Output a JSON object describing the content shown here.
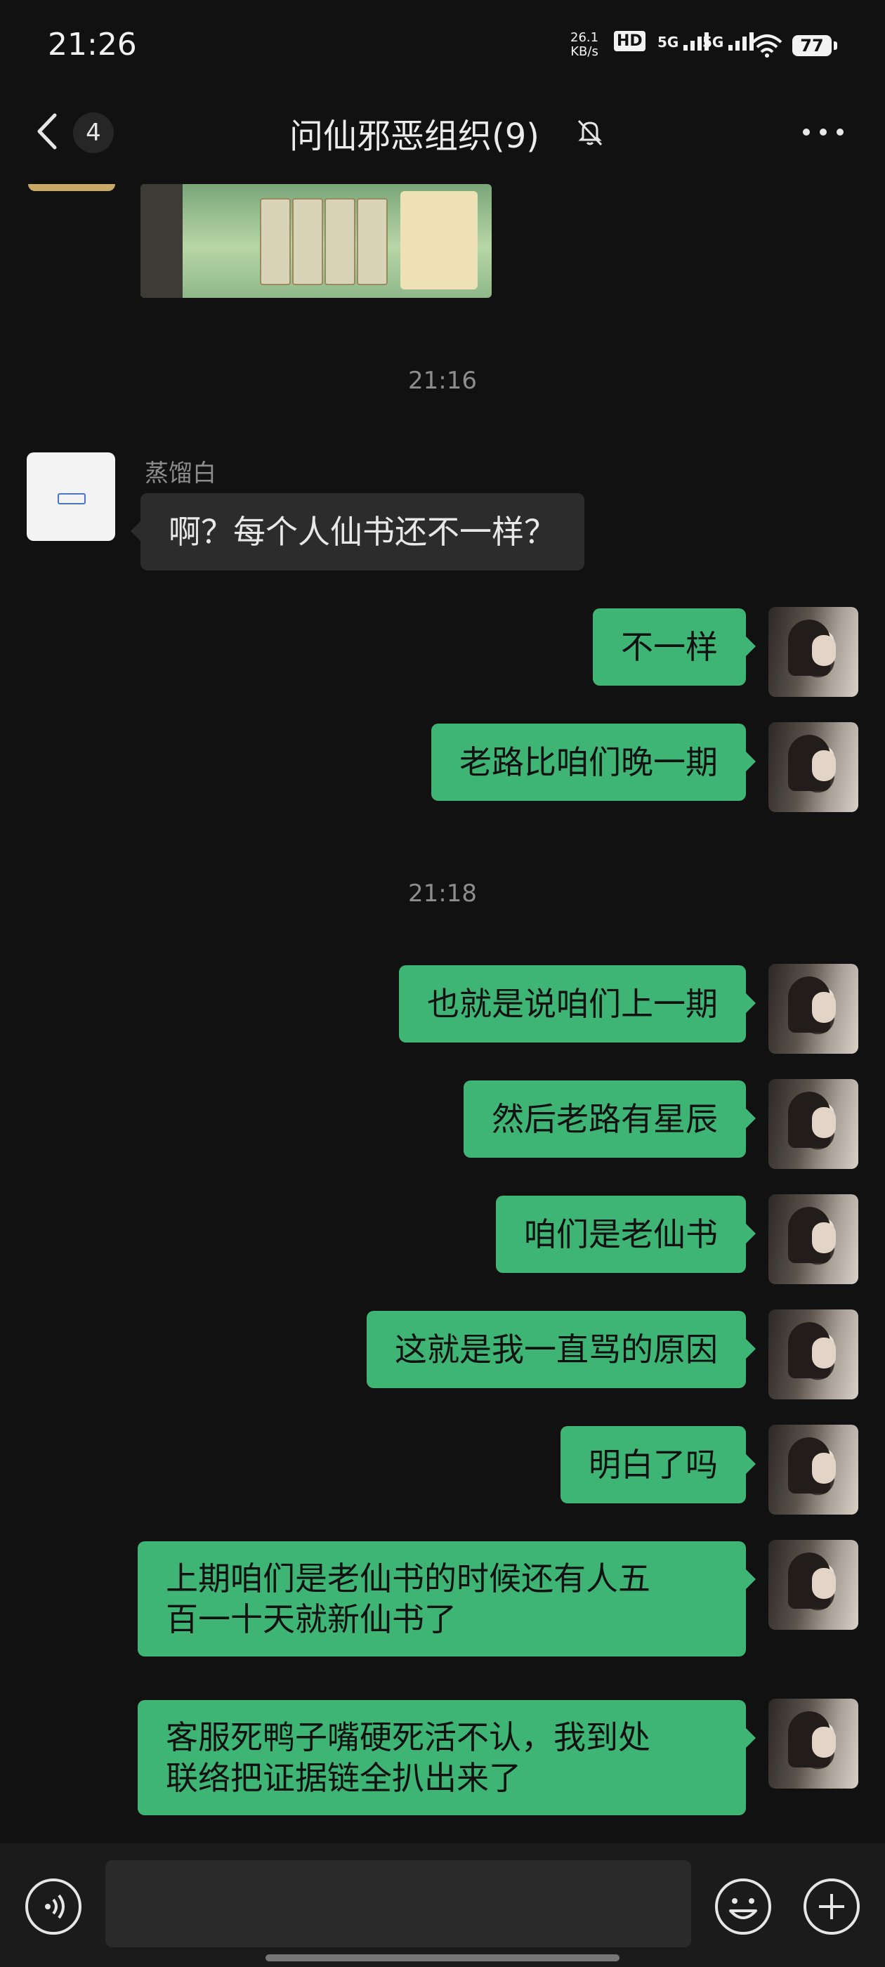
{
  "status_bar": {
    "time": "21:26",
    "net_speed": "26.1",
    "net_unit": "KB/s",
    "hd_label": "HD",
    "signal_1": "5G",
    "signal_2": "5G",
    "battery": "77"
  },
  "header": {
    "unread_count": "4",
    "title": "问仙邪恶组织(9)"
  },
  "timestamps": [
    "21:16",
    "21:18"
  ],
  "messages": [
    {
      "side": "in",
      "sender": "蒸馏白",
      "text": "啊？每个人仙书还不一样？"
    },
    {
      "side": "out",
      "text": "不一样"
    },
    {
      "side": "out",
      "text": "老路比咱们晚一期"
    },
    {
      "side": "out",
      "text": "也就是说咱们上一期"
    },
    {
      "side": "out",
      "text": "然后老路有星辰"
    },
    {
      "side": "out",
      "text": "咱们是老仙书"
    },
    {
      "side": "out",
      "text": "这就是我一直骂的原因"
    },
    {
      "side": "out",
      "text": "明白了吗"
    },
    {
      "side": "out",
      "text_lines": [
        "上期咱们是老仙书的时候还有人五",
        "百一十天就新仙书了"
      ]
    },
    {
      "side": "out",
      "text_lines": [
        "客服死鸭子嘴硬死活不认，我到处",
        "联络把证据链全扒出来了"
      ]
    }
  ],
  "input": {
    "value": "",
    "placeholder": ""
  },
  "colors": {
    "background": "#111111",
    "bubble_out": "#3eb574",
    "bubble_in": "#2c2c2c",
    "timestamp": "#8d8d8d"
  }
}
